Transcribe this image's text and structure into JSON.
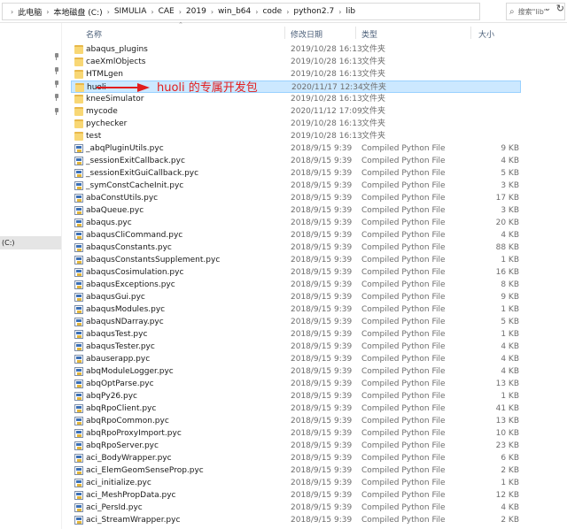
{
  "address_bar": {
    "crumbs": [
      "此电脑",
      "本地磁盘 (C:)",
      "SIMULIA",
      "CAE",
      "2019",
      "win_b64",
      "code",
      "python2.7",
      "lib"
    ]
  },
  "search": {
    "placeholder": "搜索\"lib\""
  },
  "nav": {
    "drive_label": "(C:)"
  },
  "columns": {
    "name": "名称",
    "date": "修改日期",
    "type": "类型",
    "size": "大小"
  },
  "annotation": {
    "text": "huoli 的专属开发包"
  },
  "files": [
    {
      "name": "abaqus_plugins",
      "date": "2019/10/28 16:13",
      "type": "文件夹",
      "size": "",
      "kind": "folder"
    },
    {
      "name": "caeXmlObjects",
      "date": "2019/10/28 16:13",
      "type": "文件夹",
      "size": "",
      "kind": "folder"
    },
    {
      "name": "HTMLgen",
      "date": "2019/10/28 16:13",
      "type": "文件夹",
      "size": "",
      "kind": "folder"
    },
    {
      "name": "huoli",
      "date": "2020/11/17 12:34",
      "type": "文件夹",
      "size": "",
      "kind": "folder",
      "selected": true
    },
    {
      "name": "kneeSimulator",
      "date": "2019/10/28 16:13",
      "type": "文件夹",
      "size": "",
      "kind": "folder"
    },
    {
      "name": "mycode",
      "date": "2020/11/12 17:09",
      "type": "文件夹",
      "size": "",
      "kind": "folder"
    },
    {
      "name": "pychecker",
      "date": "2019/10/28 16:13",
      "type": "文件夹",
      "size": "",
      "kind": "folder"
    },
    {
      "name": "test",
      "date": "2019/10/28 16:13",
      "type": "文件夹",
      "size": "",
      "kind": "folder"
    },
    {
      "name": "_abqPluginUtils.pyc",
      "date": "2018/9/15 9:39",
      "type": "Compiled Python File",
      "size": "9 KB",
      "kind": "file"
    },
    {
      "name": "_sessionExitCallback.pyc",
      "date": "2018/9/15 9:39",
      "type": "Compiled Python File",
      "size": "4 KB",
      "kind": "file"
    },
    {
      "name": "_sessionExitGuiCallback.pyc",
      "date": "2018/9/15 9:39",
      "type": "Compiled Python File",
      "size": "5 KB",
      "kind": "file"
    },
    {
      "name": "_symConstCacheInit.pyc",
      "date": "2018/9/15 9:39",
      "type": "Compiled Python File",
      "size": "3 KB",
      "kind": "file"
    },
    {
      "name": "abaConstUtils.pyc",
      "date": "2018/9/15 9:39",
      "type": "Compiled Python File",
      "size": "17 KB",
      "kind": "file"
    },
    {
      "name": "abaQueue.pyc",
      "date": "2018/9/15 9:39",
      "type": "Compiled Python File",
      "size": "3 KB",
      "kind": "file"
    },
    {
      "name": "abaqus.pyc",
      "date": "2018/9/15 9:39",
      "type": "Compiled Python File",
      "size": "20 KB",
      "kind": "file"
    },
    {
      "name": "abaqusCliCommand.pyc",
      "date": "2018/9/15 9:39",
      "type": "Compiled Python File",
      "size": "4 KB",
      "kind": "file"
    },
    {
      "name": "abaqusConstants.pyc",
      "date": "2018/9/15 9:39",
      "type": "Compiled Python File",
      "size": "88 KB",
      "kind": "file"
    },
    {
      "name": "abaqusConstantsSupplement.pyc",
      "date": "2018/9/15 9:39",
      "type": "Compiled Python File",
      "size": "1 KB",
      "kind": "file"
    },
    {
      "name": "abaqusCosimulation.pyc",
      "date": "2018/9/15 9:39",
      "type": "Compiled Python File",
      "size": "16 KB",
      "kind": "file"
    },
    {
      "name": "abaqusExceptions.pyc",
      "date": "2018/9/15 9:39",
      "type": "Compiled Python File",
      "size": "8 KB",
      "kind": "file"
    },
    {
      "name": "abaqusGui.pyc",
      "date": "2018/9/15 9:39",
      "type": "Compiled Python File",
      "size": "9 KB",
      "kind": "file"
    },
    {
      "name": "abaqusModules.pyc",
      "date": "2018/9/15 9:39",
      "type": "Compiled Python File",
      "size": "1 KB",
      "kind": "file"
    },
    {
      "name": "abaqusNDarray.pyc",
      "date": "2018/9/15 9:39",
      "type": "Compiled Python File",
      "size": "5 KB",
      "kind": "file"
    },
    {
      "name": "abaqusTest.pyc",
      "date": "2018/9/15 9:39",
      "type": "Compiled Python File",
      "size": "1 KB",
      "kind": "file"
    },
    {
      "name": "abaqusTester.pyc",
      "date": "2018/9/15 9:39",
      "type": "Compiled Python File",
      "size": "4 KB",
      "kind": "file"
    },
    {
      "name": "abauserapp.pyc",
      "date": "2018/9/15 9:39",
      "type": "Compiled Python File",
      "size": "4 KB",
      "kind": "file"
    },
    {
      "name": "abqModuleLogger.pyc",
      "date": "2018/9/15 9:39",
      "type": "Compiled Python File",
      "size": "4 KB",
      "kind": "file"
    },
    {
      "name": "abqOptParse.pyc",
      "date": "2018/9/15 9:39",
      "type": "Compiled Python File",
      "size": "13 KB",
      "kind": "file"
    },
    {
      "name": "abqPy26.pyc",
      "date": "2018/9/15 9:39",
      "type": "Compiled Python File",
      "size": "1 KB",
      "kind": "file"
    },
    {
      "name": "abqRpoClient.pyc",
      "date": "2018/9/15 9:39",
      "type": "Compiled Python File",
      "size": "41 KB",
      "kind": "file"
    },
    {
      "name": "abqRpoCommon.pyc",
      "date": "2018/9/15 9:39",
      "type": "Compiled Python File",
      "size": "13 KB",
      "kind": "file"
    },
    {
      "name": "abqRpoProxyImport.pyc",
      "date": "2018/9/15 9:39",
      "type": "Compiled Python File",
      "size": "10 KB",
      "kind": "file"
    },
    {
      "name": "abqRpoServer.pyc",
      "date": "2018/9/15 9:39",
      "type": "Compiled Python File",
      "size": "23 KB",
      "kind": "file"
    },
    {
      "name": "aci_BodyWrapper.pyc",
      "date": "2018/9/15 9:39",
      "type": "Compiled Python File",
      "size": "6 KB",
      "kind": "file"
    },
    {
      "name": "aci_ElemGeomSenseProp.pyc",
      "date": "2018/9/15 9:39",
      "type": "Compiled Python File",
      "size": "2 KB",
      "kind": "file"
    },
    {
      "name": "aci_initialize.pyc",
      "date": "2018/9/15 9:39",
      "type": "Compiled Python File",
      "size": "1 KB",
      "kind": "file"
    },
    {
      "name": "aci_MeshPropData.pyc",
      "date": "2018/9/15 9:39",
      "type": "Compiled Python File",
      "size": "12 KB",
      "kind": "file"
    },
    {
      "name": "aci_PersId.pyc",
      "date": "2018/9/15 9:39",
      "type": "Compiled Python File",
      "size": "4 KB",
      "kind": "file"
    },
    {
      "name": "aci_StreamWrapper.pyc",
      "date": "2018/9/15 9:39",
      "type": "Compiled Python File",
      "size": "2 KB",
      "kind": "file"
    }
  ]
}
